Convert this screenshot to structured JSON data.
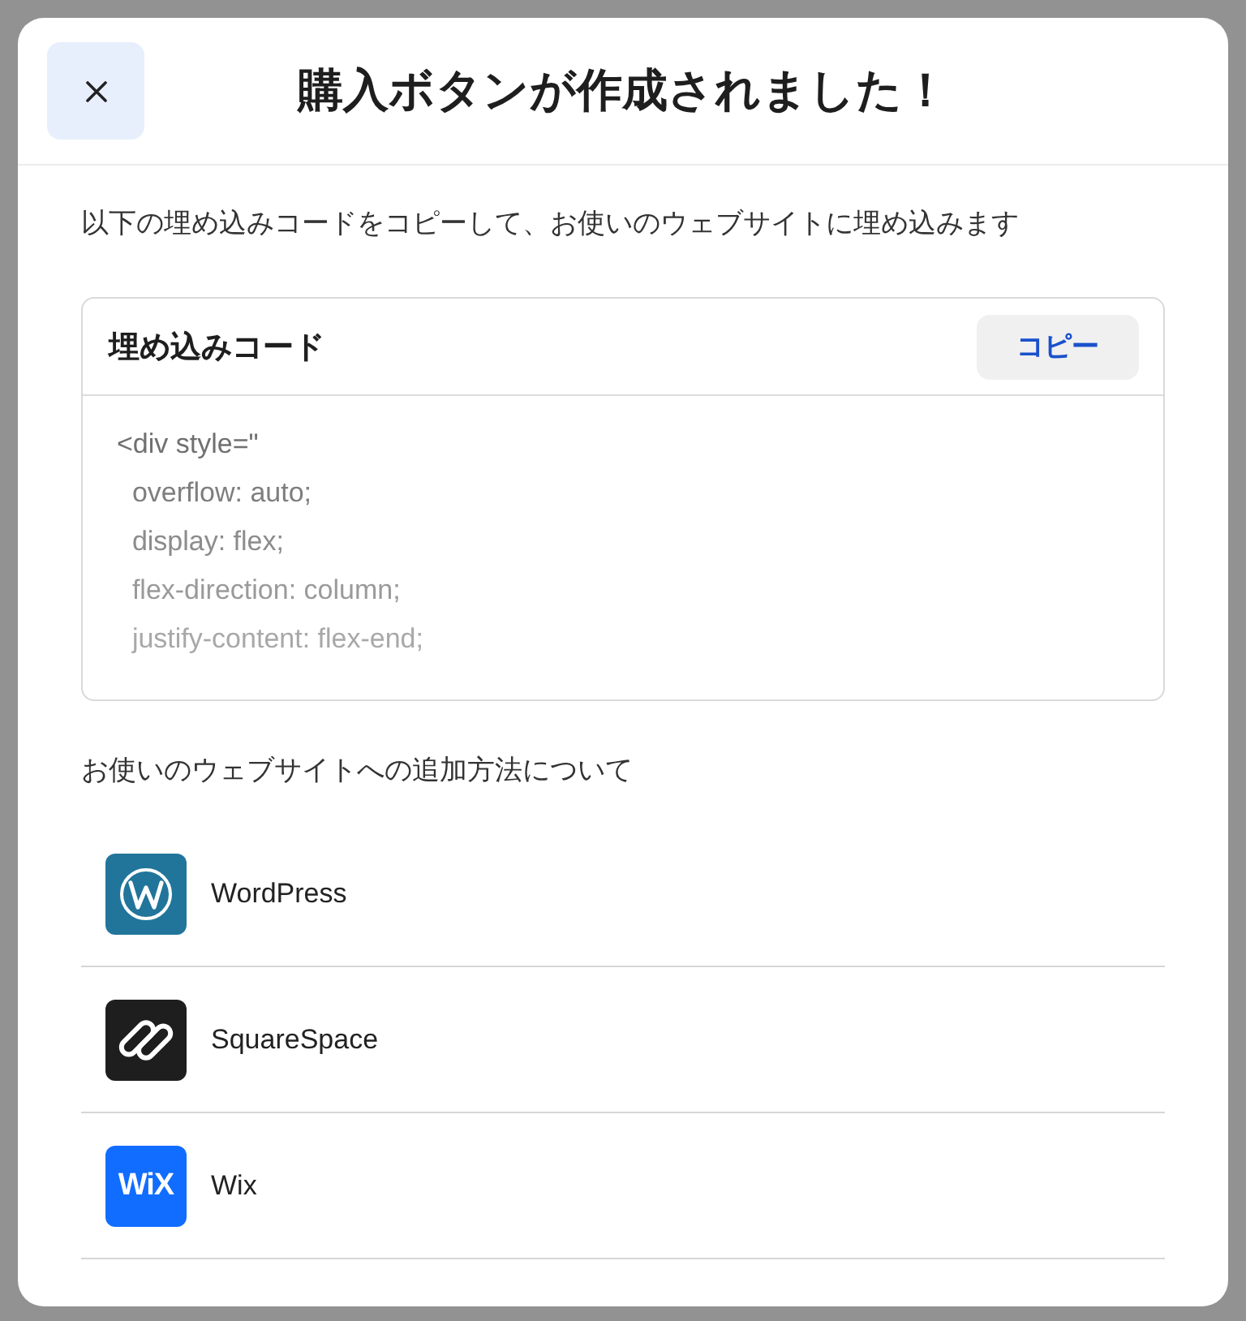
{
  "dialog": {
    "title": "購入ボタンが作成されました！"
  },
  "instructions": "以下の埋め込みコードをコピーして、お使いのウェブサイトに埋め込みます",
  "embed_code": {
    "title": "埋め込みコード",
    "copy_button": "コピー",
    "lines": [
      "<div style=\"",
      "  overflow: auto;",
      "  display: flex;",
      "  flex-direction: column;",
      "  justify-content: flex-end;"
    ]
  },
  "platforms_heading": "お使いのウェブサイトへの追加方法について",
  "platforms": [
    {
      "kind": "wordpress",
      "name": "WordPress"
    },
    {
      "kind": "squarespace",
      "name": "SquareSpace"
    },
    {
      "kind": "wix",
      "name": "Wix",
      "logo_text": "WiX"
    }
  ]
}
